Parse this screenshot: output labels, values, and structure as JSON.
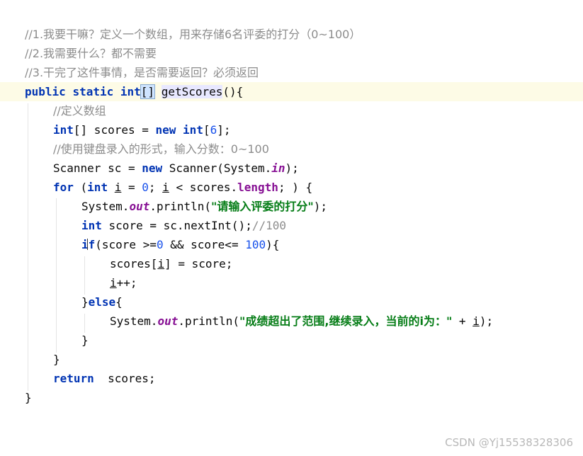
{
  "editor": {
    "comment1": "//1.我要干嘛？定义一个数组，用来存储6名评委的打分（0~100）",
    "comment2": "//2.我需要什么？都不需要",
    "comment3": "//3.干完了这件事情，是否需要返回？必须返回",
    "sig_public": "public",
    "sig_static": "static",
    "sig_int": "int",
    "sig_brackets": "[]",
    "sig_method": "getScores",
    "sig_tail": "(){",
    "comment_define": "//定义数组",
    "decl_int": "int",
    "decl_mid": "[] scores = ",
    "decl_new": "new",
    "decl_int2": "int",
    "decl_open": "[",
    "decl_size": "6",
    "decl_close": "];",
    "comment_input": "//使用键盘录入的形式，输入分数：0~100",
    "scanner_a": "Scanner sc = ",
    "scanner_new": "new",
    "scanner_b": " Scanner(System.",
    "scanner_in": "in",
    "scanner_c": ");",
    "for_kw": "for",
    "for_open": " (",
    "for_int": "int",
    "for_sp": " ",
    "for_i1": "i",
    "for_eq": " = ",
    "for_zero": "0",
    "for_semi": "; ",
    "for_i2": "i",
    "for_lt": " < scores.",
    "for_length": "length",
    "for_end": "; ) {",
    "p1_a": "System.",
    "p1_out": "out",
    "p1_b": ".println(",
    "p1_str": "\"请输入评委的打分\"",
    "p1_c": ");",
    "score_int": "int",
    "score_rest": " score = sc.nextInt();",
    "score_comment": "//100",
    "if_kw": "if",
    "if_a": "(score >=",
    "if_zero": "0",
    "if_b": " && score<= ",
    "if_hundred": "100",
    "if_c": "){",
    "assign_a": "scores[",
    "assign_i": "i",
    "assign_b": "] = score;",
    "inc_i": "i",
    "inc_rest": "++;",
    "else_a": "}",
    "else_kw": "else",
    "else_b": "{",
    "p2_a": "System.",
    "p2_out": "out",
    "p2_b": ".println(",
    "p2_str": "\"成绩超出了范围,继续录入，当前的i为：\"",
    "p2_c": " + ",
    "p2_i": "i",
    "p2_d": ");",
    "close_if": "}",
    "close_for": "}",
    "return_kw": "return",
    "return_rest": "  scores;",
    "close_method": "}"
  },
  "watermark": "CSDN @Yj15538328306",
  "icons": {
    "gutter": "lightbulb-icon"
  },
  "colors": {
    "keyword": "#0033b3",
    "comment": "#8c8c8c",
    "number": "#1750eb",
    "string": "#067d17",
    "field": "#871094",
    "current_line": "#fdfbe6"
  }
}
